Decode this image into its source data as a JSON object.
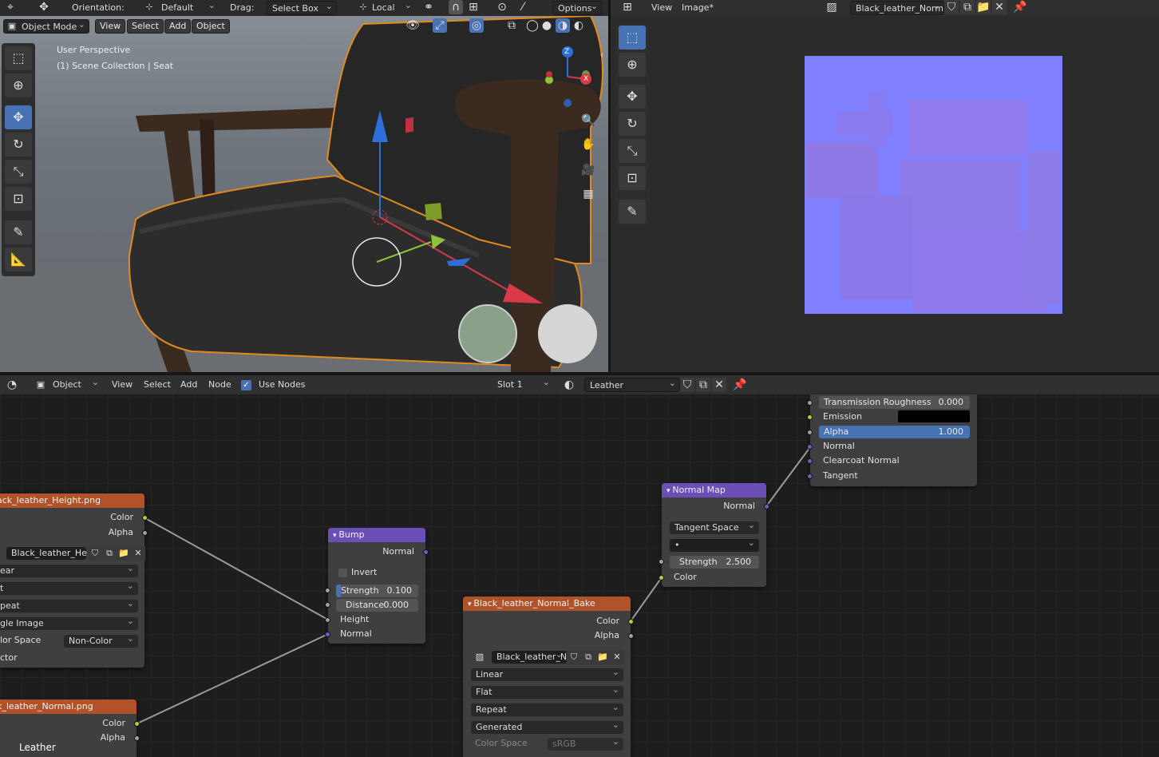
{
  "viewport": {
    "header": {
      "orientation_label": "Orientation:",
      "orientation_value": "Default",
      "drag_label": "Drag:",
      "drag_value": "Select Box",
      "pivot_value": "Local",
      "options_label": "Options"
    },
    "menu": {
      "mode": "Object Mode",
      "view": "View",
      "select": "Select",
      "add": "Add",
      "object": "Object"
    },
    "overlay": {
      "perspective": "User Perspective",
      "collection": "(1) Scene Collection | Seat"
    },
    "axis": {
      "z": "Z",
      "x": "X"
    }
  },
  "image_editor": {
    "view": "View",
    "image": "Image*",
    "image_name": "Black_leather_Norm..."
  },
  "node_editor": {
    "header": {
      "object": "Object",
      "view": "View",
      "select": "Select",
      "add": "Add",
      "node": "Node",
      "use_nodes": "Use Nodes",
      "slot": "Slot 1",
      "material": "Leather"
    },
    "principled": {
      "trans_rough_label": "Transmission Roughness",
      "trans_rough_value": "0.000",
      "emission": "Emission",
      "alpha_label": "Alpha",
      "alpha_value": "1.000",
      "normal": "Normal",
      "clearcoat_normal": "Clearcoat Normal",
      "tangent": "Tangent"
    },
    "normal_map": {
      "title": "Normal Map",
      "out_normal": "Normal",
      "space": "Tangent Space",
      "uv": "•",
      "strength_label": "Strength",
      "strength_value": "2.500",
      "color": "Color"
    },
    "bump": {
      "title": "Bump",
      "out_normal": "Normal",
      "invert": "Invert",
      "strength_label": "Strength",
      "strength_value": "0.100",
      "distance_label": "Distance",
      "distance_value": "0.000",
      "height": "Height",
      "normal": "Normal"
    },
    "height_tex": {
      "title": "ack_leather_Height.png",
      "color": "Color",
      "alpha": "Alpha",
      "image": "Black_leather_He...",
      "interp": "ear",
      "proj": "t",
      "ext": "peat",
      "source": "gle Image",
      "cs_label": "lor Space",
      "cs_value": "Non-Color",
      "vector": "ctor"
    },
    "normal_tex": {
      "title": "k_leather_Normal.png",
      "color": "Color",
      "alpha": "Alpha",
      "material_label": "Leather"
    },
    "bake_tex": {
      "title": "Black_leather_Normal_Bake",
      "color": "Color",
      "alpha": "Alpha",
      "image": "Black_leather_No...",
      "interp": "Linear",
      "proj": "Flat",
      "ext": "Repeat",
      "source": "Generated",
      "cs_label": "Color Space",
      "cs_value": "sRGB"
    }
  }
}
